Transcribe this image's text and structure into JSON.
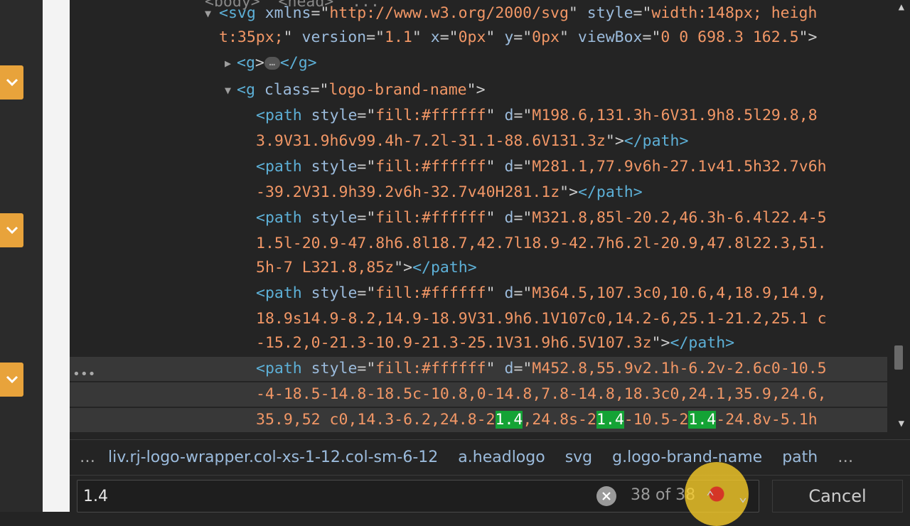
{
  "dom_tree": {
    "partial_top": "<body>  <head>  ...",
    "lines": [
      {
        "tri": "▼",
        "pre": "<",
        "tag": "svg",
        "segs": [
          [
            "attr",
            "xmlns"
          ],
          [
            "txt",
            "=\""
          ],
          [
            "val",
            "http://www.w3.org/2000/svg"
          ],
          [
            "txt",
            "\" "
          ],
          [
            "attr",
            "style"
          ],
          [
            "txt",
            "=\""
          ],
          [
            "val",
            "width:148px; heigh"
          ]
        ]
      },
      {
        "tri": "",
        "pre": "",
        "tag": "",
        "segs": [
          [
            "val",
            "t:35px;"
          ],
          [
            "txt",
            "\" "
          ],
          [
            "attr",
            "version"
          ],
          [
            "txt",
            "=\""
          ],
          [
            "val",
            "1.1"
          ],
          [
            "txt",
            "\" "
          ],
          [
            "attr",
            "x"
          ],
          [
            "txt",
            "=\""
          ],
          [
            "val",
            "0px"
          ],
          [
            "txt",
            "\" "
          ],
          [
            "attr",
            "y"
          ],
          [
            "txt",
            "=\""
          ],
          [
            "val",
            "0px"
          ],
          [
            "txt",
            "\" "
          ],
          [
            "attr",
            "viewBox"
          ],
          [
            "txt",
            "=\""
          ],
          [
            "val",
            "0 0 698.3 162.5"
          ],
          [
            "txt",
            "\">"
          ]
        ]
      },
      {
        "tri": "▶",
        "pre": "<",
        "tag": "g",
        "segs": [
          [
            "txt",
            ">"
          ],
          [
            "ellip",
            "…"
          ],
          [
            "tag",
            "</g>"
          ]
        ]
      },
      {
        "tri": "▼",
        "pre": "<",
        "tag": "g",
        "segs": [
          [
            "attr",
            " class"
          ],
          [
            "txt",
            "=\""
          ],
          [
            "val",
            "logo-brand-name"
          ],
          [
            "txt",
            "\">"
          ]
        ]
      },
      {
        "tri": "",
        "pre": "<",
        "tag": "path",
        "segs": [
          [
            "attr",
            " style"
          ],
          [
            "txt",
            "=\""
          ],
          [
            "val",
            "fill:#ffffff"
          ],
          [
            "txt",
            "\" "
          ],
          [
            "attr",
            "d"
          ],
          [
            "txt",
            "=\""
          ],
          [
            "val",
            "M198.6,131.3h-6V31.9h8.5l29.8,8"
          ]
        ]
      },
      {
        "tri": "",
        "pre": "",
        "tag": "",
        "segs": [
          [
            "val",
            "3.9V31.9h6v99.4h-7.2l-31.1-88.6V131.3z"
          ],
          [
            "txt",
            "\">"
          ],
          [
            "tag",
            "</path>"
          ]
        ]
      },
      {
        "tri": "",
        "pre": "<",
        "tag": "path",
        "segs": [
          [
            "attr",
            " style"
          ],
          [
            "txt",
            "=\""
          ],
          [
            "val",
            "fill:#ffffff"
          ],
          [
            "txt",
            "\" "
          ],
          [
            "attr",
            "d"
          ],
          [
            "txt",
            "=\""
          ],
          [
            "val",
            "M281.1,77.9v6h-27.1v41.5h32.7v6h"
          ]
        ]
      },
      {
        "tri": "",
        "pre": "",
        "tag": "",
        "segs": [
          [
            "val",
            "-39.2V31.9h39.2v6h-32.7v40H281.1z"
          ],
          [
            "txt",
            "\">"
          ],
          [
            "tag",
            "</path>"
          ]
        ]
      },
      {
        "tri": "",
        "pre": "<",
        "tag": "path",
        "segs": [
          [
            "attr",
            " style"
          ],
          [
            "txt",
            "=\""
          ],
          [
            "val",
            "fill:#ffffff"
          ],
          [
            "txt",
            "\" "
          ],
          [
            "attr",
            "d"
          ],
          [
            "txt",
            "=\""
          ],
          [
            "val",
            "M321.8,85l-20.2,46.3h-6.4l22.4-5"
          ]
        ]
      },
      {
        "tri": "",
        "pre": "",
        "tag": "",
        "segs": [
          [
            "val",
            "1.5l-20.9-47.8h6.8l18.7,42.7l18.9-42.7h6.2l-20.9,47.8l22.3,51."
          ]
        ]
      },
      {
        "tri": "",
        "pre": "",
        "tag": "",
        "segs": [
          [
            "val",
            "5h-7 L321.8,85z"
          ],
          [
            "txt",
            "\">"
          ],
          [
            "tag",
            "</path>"
          ]
        ]
      },
      {
        "tri": "",
        "pre": "<",
        "tag": "path",
        "segs": [
          [
            "attr",
            " style"
          ],
          [
            "txt",
            "=\""
          ],
          [
            "val",
            "fill:#ffffff"
          ],
          [
            "txt",
            "\" "
          ],
          [
            "attr",
            "d"
          ],
          [
            "txt",
            "=\""
          ],
          [
            "val",
            "M364.5,107.3c0,10.6,4,18.9,14.9,"
          ]
        ]
      },
      {
        "tri": "",
        "pre": "",
        "tag": "",
        "segs": [
          [
            "val",
            "18.9s14.9-8.2,14.9-18.9V31.9h6.1V107c0,14.2-6,25.1-21.2,25.1 c"
          ]
        ]
      },
      {
        "tri": "",
        "pre": "",
        "tag": "",
        "segs": [
          [
            "val",
            "-15.2,0-21.3-10.9-21.3-25.1V31.9h6.5V107.3z"
          ],
          [
            "txt",
            "\">"
          ],
          [
            "tag",
            "</path>"
          ]
        ]
      },
      {
        "tri": "",
        "pre": "<",
        "tag": "path",
        "segs": [
          [
            "attr",
            " style"
          ],
          [
            "txt",
            "=\""
          ],
          [
            "val",
            "fill:#ffffff"
          ],
          [
            "txt",
            "\" "
          ],
          [
            "attr",
            "d"
          ],
          [
            "txt",
            "=\""
          ],
          [
            "val",
            "M452.8,55.9v2.1h-6.2v-2.6c0-10.5"
          ]
        ]
      },
      {
        "tri": "",
        "pre": "",
        "tag": "",
        "segs": [
          [
            "val",
            "-4-18.5-14.8-18.5c-10.8,0-14.8,7.8-14.8,18.3c0,24.1,35.9,24.6,"
          ]
        ]
      },
      {
        "tri": "",
        "pre": "",
        "tag": "",
        "segs": [
          [
            "val",
            "35.9,52 c0,14.3-6.2,24.8-2"
          ],
          [
            "hl",
            "1.4"
          ],
          [
            "val",
            ",24.8s-2"
          ],
          [
            "hl",
            "1.4"
          ],
          [
            "val",
            "-10.5-2"
          ],
          [
            "hl",
            "1.4"
          ],
          [
            "val",
            "-24.8v-5.1h"
          ]
        ]
      }
    ]
  },
  "breadcrumbs": {
    "more_left": "…",
    "items": [
      "liv.rj-logo-wrapper.col-xs-1-12.col-sm-6-12",
      "a.headlogo",
      "svg",
      "g.logo-brand-name",
      "path"
    ],
    "more_right": "…"
  },
  "search": {
    "query": "1.4",
    "match_count": "38 of 38",
    "cancel_label": "Cancel"
  },
  "colors": {
    "tag": "#5db0d7",
    "attr": "#9bbbdc",
    "value": "#f29766",
    "highlight": "#14a335",
    "accent_tab": "#e8a33b"
  }
}
